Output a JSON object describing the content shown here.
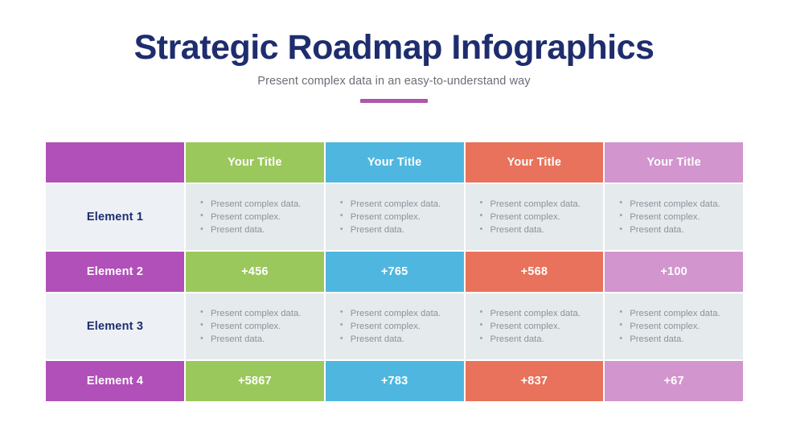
{
  "header": {
    "title": "Strategic Roadmap Infographics",
    "subtitle": "Present complex data in an easy-to-understand way",
    "accent_color": "#ad57ad",
    "title_color": "#1e2d6e",
    "subtitle_color": "#6c6d77"
  },
  "table": {
    "column_colors": [
      "#b050b8",
      "#9bc85c",
      "#4fb7df",
      "#e8725b",
      "#d295ce"
    ],
    "bullet_row_label_bg": "#edf0f4",
    "bullet_row_cell_bg": "#e5eaec",
    "column_headers": [
      {
        "label": "",
        "color": "#b050b8"
      },
      {
        "label": "Your Title",
        "color": "#b050b8"
      },
      {
        "label": "Your Title",
        "color": "#9bc85c"
      },
      {
        "label": "Your Title",
        "color": "#4fb7df"
      },
      {
        "label": "Your Title",
        "color": "#e8725b"
      },
      {
        "label": "Your Title",
        "color": "#d295ce"
      }
    ],
    "header_first_label": "Your Title",
    "bullets": [
      "Present complex data.",
      "Present complex.",
      "Present data."
    ],
    "rows": [
      {
        "label": "Element 1",
        "type": "bullets",
        "cells": [
          [
            "Present complex data.",
            "Present complex.",
            "Present data."
          ],
          [
            "Present complex data.",
            "Present complex.",
            "Present data."
          ],
          [
            "Present complex data.",
            "Present complex.",
            "Present data."
          ],
          [
            "Present complex data.",
            "Present complex.",
            "Present data."
          ]
        ]
      },
      {
        "label": "Element 2",
        "type": "values",
        "values": [
          "+456",
          "+765",
          "+568",
          "+100"
        ]
      },
      {
        "label": "Element 3",
        "type": "bullets",
        "cells": [
          [
            "Present complex data.",
            "Present complex.",
            "Present data."
          ],
          [
            "Present complex data.",
            "Present complex.",
            "Present data."
          ],
          [
            "Present complex data.",
            "Present complex.",
            "Present data."
          ],
          [
            "Present complex data.",
            "Present complex.",
            "Present data."
          ]
        ]
      },
      {
        "label": "Element 4",
        "type": "values",
        "values": [
          "+5867",
          "+783",
          "+837",
          "+67"
        ]
      }
    ]
  }
}
